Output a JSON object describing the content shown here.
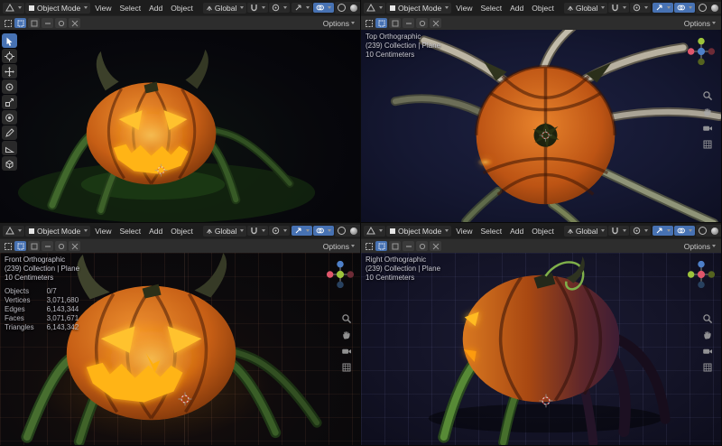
{
  "colors": {
    "accent": "#4772b3",
    "header_bg": "#1d1d1d",
    "toolsettings_bg": "#2d2d2d"
  },
  "header": {
    "mode": "Object Mode",
    "menus": [
      "View",
      "Select",
      "Add",
      "Object"
    ],
    "orientation": "Global",
    "options": "Options"
  },
  "viewports": {
    "perspective": {
      "name": "user-perspective-view"
    },
    "top": {
      "view": "Top Orthographic",
      "collection": "(239) Collection | Plane",
      "units": "10 Centimeters"
    },
    "front": {
      "view": "Front Orthographic",
      "collection": "(239) Collection | Plane",
      "units": "10 Centimeters",
      "stats": {
        "labels": [
          "Objects",
          "Vertices",
          "Edges",
          "Faces",
          "Triangles"
        ],
        "values": [
          "0/7",
          "3,071,680",
          "6,143,344",
          "3,071,671",
          "6,143,342"
        ]
      }
    },
    "right": {
      "view": "Right Orthographic",
      "collection": "(239) Collection | Plane",
      "units": "10 Centimeters"
    }
  },
  "toolbar_icons": [
    "select-box",
    "cursor",
    "move",
    "rotate",
    "scale",
    "transform",
    "annotate",
    "measure",
    "add-cube"
  ],
  "nav_icons": [
    "zoom",
    "pan",
    "camera",
    "toggle-grid"
  ],
  "gizmo_axes": {
    "x": "#e0566b",
    "y": "#9dc43b",
    "z": "#4e80c9"
  }
}
